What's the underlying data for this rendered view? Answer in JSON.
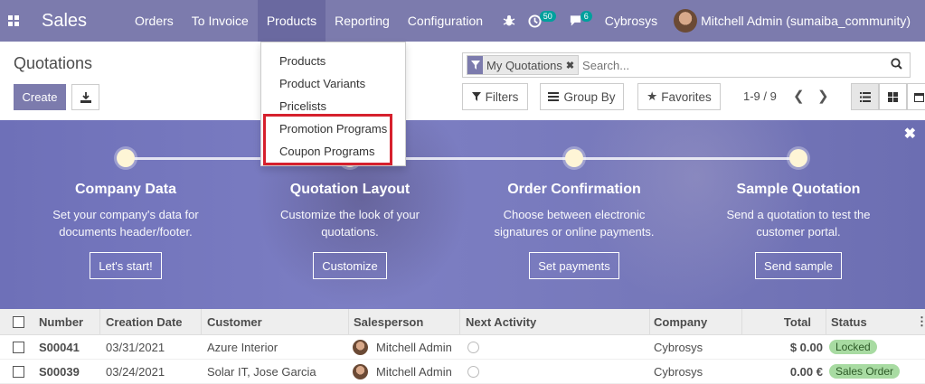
{
  "navbar": {
    "brand": "Sales",
    "menu": [
      "Orders",
      "To Invoice",
      "Products",
      "Reporting",
      "Configuration"
    ],
    "active_menu": "Products",
    "activity_count": "50",
    "message_count": "6",
    "company": "Cybrosys",
    "user": "Mitchell Admin (sumaiba_community)"
  },
  "products_menu": {
    "items": [
      "Products",
      "Product Variants",
      "Pricelists",
      "Promotion Programs",
      "Coupon Programs"
    ],
    "highlighted": [
      "Promotion Programs",
      "Coupon Programs"
    ],
    "highlight_color": "#d6202d"
  },
  "control_panel": {
    "title": "Quotations",
    "create_label": "Create",
    "search_facet": "My Quotations",
    "search_placeholder": "Search...",
    "filters_label": "Filters",
    "groupby_label": "Group By",
    "favorites_label": "Favorites",
    "pager": "1-9 / 9"
  },
  "banner": {
    "steps": [
      {
        "title": "Company Data",
        "line1": "Set your company's data for",
        "line2": "documents header/footer.",
        "button": "Let's start!"
      },
      {
        "title": "Quotation Layout",
        "line1": "Customize the look of your",
        "line2": "quotations.",
        "button": "Customize"
      },
      {
        "title": "Order Confirmation",
        "line1": "Choose between electronic",
        "line2": "signatures or online payments.",
        "button": "Set payments"
      },
      {
        "title": "Sample Quotation",
        "line1": "Send a quotation to test the",
        "line2": "customer portal.",
        "button": "Send sample"
      }
    ]
  },
  "table": {
    "headers": {
      "number": "Number",
      "creation_date": "Creation Date",
      "customer": "Customer",
      "salesperson": "Salesperson",
      "next_activity": "Next Activity",
      "company": "Company",
      "total": "Total",
      "status": "Status"
    },
    "rows": [
      {
        "number": "S00041",
        "date": "03/31/2021",
        "customer": "Azure Interior",
        "salesperson": "Mitchell Admin",
        "company": "Cybrosys",
        "total": "$ 0.00",
        "status": "Locked"
      },
      {
        "number": "S00039",
        "date": "03/24/2021",
        "customer": "Solar IT, Jose Garcia",
        "salesperson": "Mitchell Admin",
        "company": "Cybrosys",
        "total": "0.00 €",
        "status": "Sales Order"
      }
    ]
  },
  "colors": {
    "primary": "#7c7bad",
    "status_green": "#a8dba2"
  },
  "icons": [
    "apps-grid-icon",
    "bug-icon",
    "activity-clock-icon",
    "chat-icon",
    "download-icon",
    "filter-icon",
    "remove-icon",
    "search-icon",
    "favorite-star-icon",
    "list-view-icon",
    "kanban-view-icon",
    "calendar-view-icon",
    "close-icon",
    "activity-icon",
    "column-options-icon"
  ]
}
